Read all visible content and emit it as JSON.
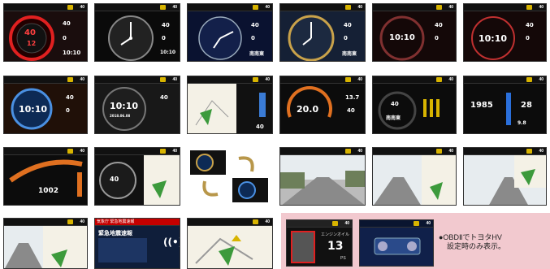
{
  "status_bar": {
    "speed": "40",
    "speed_alt": "0"
  },
  "clock": {
    "time": "10:10",
    "time_alt": "12",
    "date": "2018.06.08"
  },
  "gauges": {
    "red_value": "40",
    "dial_value_a": "40",
    "altitude": "40",
    "direction": "南南東",
    "temp": "20.0",
    "pressure": "13.7",
    "heading_deg": "1985",
    "humidity": "28",
    "volt": "9.8",
    "odo": "1002",
    "ps": "13",
    "ps_unit": "PS",
    "engine_label": "エンジンオイル"
  },
  "alert": {
    "title": "緊急地震速報",
    "header": "気象庁 緊急地震速報"
  },
  "note": {
    "line1": "●OBDⅡでトヨタHV",
    "line2": "設定時のみ表示。"
  },
  "colors": {
    "accent": "#d8b400",
    "red": "#e02020",
    "pink": "#f2c9cf"
  }
}
